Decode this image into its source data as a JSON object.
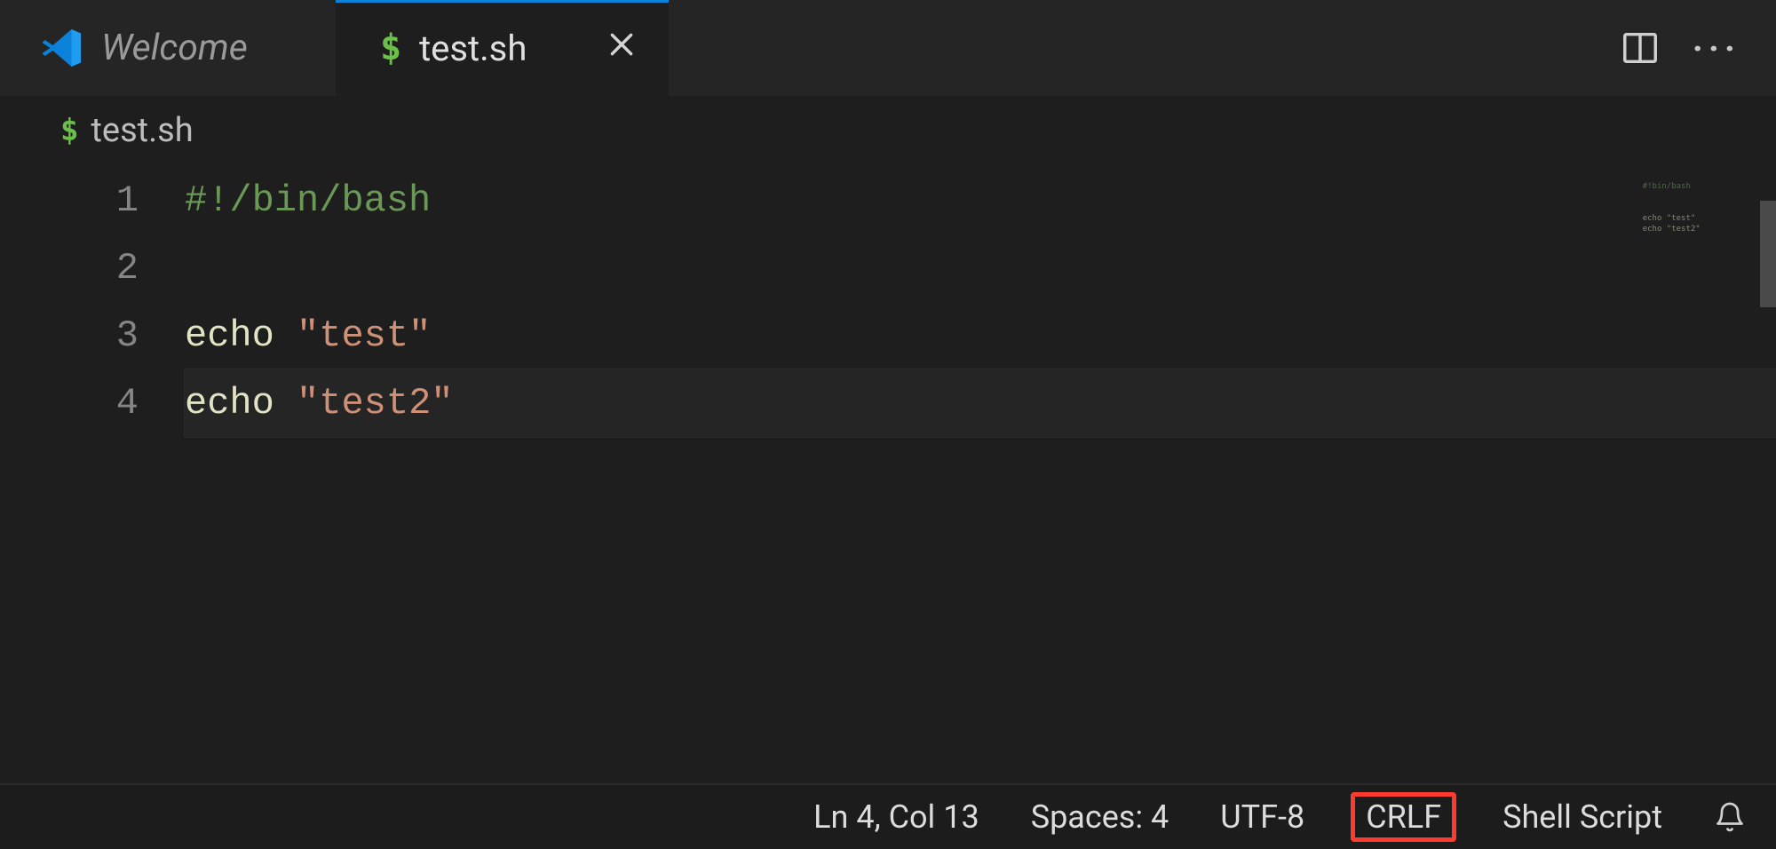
{
  "tabs": {
    "welcome": {
      "label": "Welcome"
    },
    "active": {
      "label": "test.sh",
      "icon": "$"
    }
  },
  "breadcrumb": {
    "icon": "$",
    "file": "test.sh"
  },
  "editor": {
    "line_numbers": [
      "1",
      "2",
      "3",
      "4"
    ],
    "code": {
      "l1": "#!/bin/bash",
      "l3_cmd": "echo",
      "l3_sp": " ",
      "l3_str": "\"test\"",
      "l4_cmd": "echo",
      "l4_sp": " ",
      "l4_str": "\"test2\""
    }
  },
  "minimap": {
    "l1": "#!bin/bash",
    "l3": "echo \"test\"",
    "l4": "echo \"test2\""
  },
  "status": {
    "position": "Ln 4, Col 13",
    "indent": "Spaces: 4",
    "encoding": "UTF-8",
    "eol": "CRLF",
    "language": "Shell Script"
  },
  "more_actions": "···"
}
